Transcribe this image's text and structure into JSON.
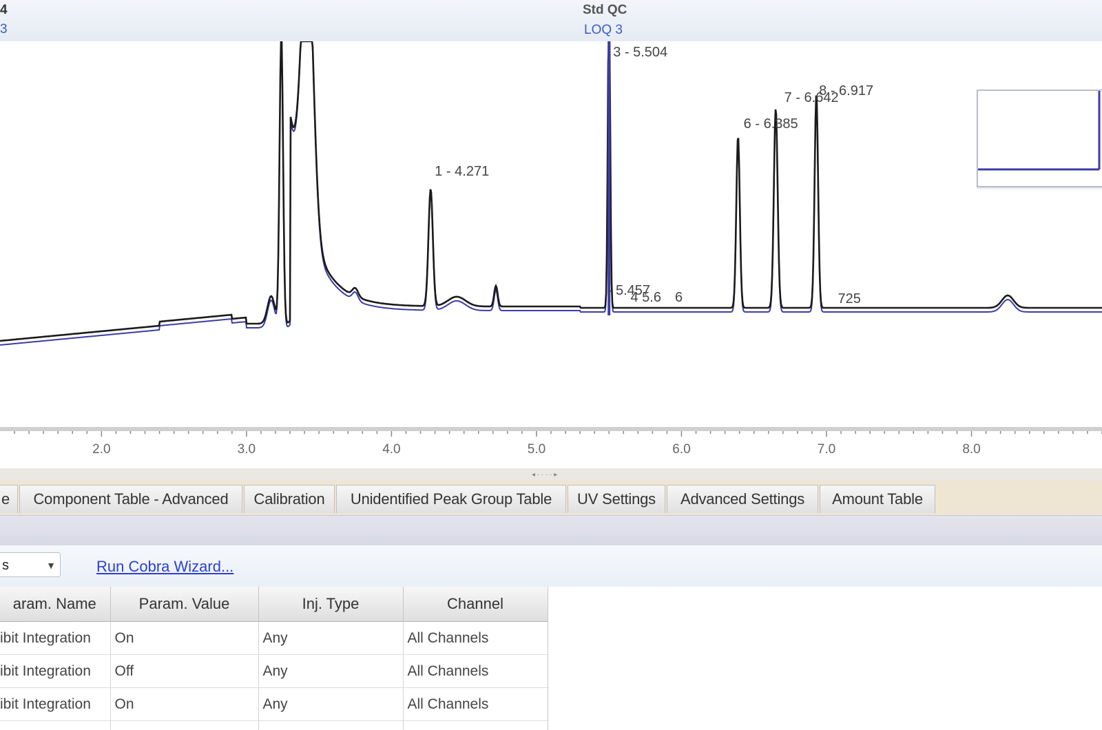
{
  "header": {
    "sample_left_top": "4",
    "sample_left_bottom": "3",
    "std_title": "Std QC",
    "std_subtitle": "LOQ 3"
  },
  "chart_data": {
    "type": "line",
    "x_tick_labels": [
      "2.0",
      "3.0",
      "4.0",
      "5.0",
      "6.0",
      "7.0",
      "8.0"
    ],
    "peak_labels": [
      {
        "text": "1 - 4.271",
        "x": 4.27
      },
      {
        "text": "3 - 5.504",
        "x": 5.5
      },
      {
        "text": "- 5.457",
        "x": 5.46
      },
      {
        "text": "4 5.6  6",
        "x": 5.62
      },
      {
        "text": "6 - 6.385",
        "x": 6.4
      },
      {
        "text": "7 - 6.642",
        "x": 6.68
      },
      {
        "text": "8 - 6.917",
        "x": 6.92
      },
      {
        "text": "725",
        "x": 7.05
      }
    ],
    "series": [
      {
        "color": "#1b1b1b"
      },
      {
        "color": "#3b3ba8"
      }
    ],
    "xlim": [
      1.3,
      8.9
    ]
  },
  "tabs": [
    {
      "label": "e"
    },
    {
      "label": "Component Table - Advanced"
    },
    {
      "label": "Calibration"
    },
    {
      "label": "Unidentified Peak Group Table"
    },
    {
      "label": "UV Settings"
    },
    {
      "label": "Advanced Settings"
    },
    {
      "label": "Amount Table"
    }
  ],
  "toolbar": {
    "dropdown_value": "s",
    "wizard_link": "Run Cobra Wizard..."
  },
  "table": {
    "columns": [
      "aram. Name",
      "Param. Value",
      "Inj. Type",
      "Channel"
    ],
    "rows": [
      [
        "ibit Integration",
        "On",
        "Any",
        "All Channels"
      ],
      [
        "ibit Integration",
        "Off",
        "Any",
        "All Channels"
      ],
      [
        "ibit Integration",
        "On",
        "Any",
        "All Channels"
      ]
    ]
  },
  "colors": {
    "trace_black": "#1b1b1b",
    "trace_blue": "#3b3ba8",
    "link": "#2b3fd6",
    "tab_strip": "#efe5d3"
  }
}
